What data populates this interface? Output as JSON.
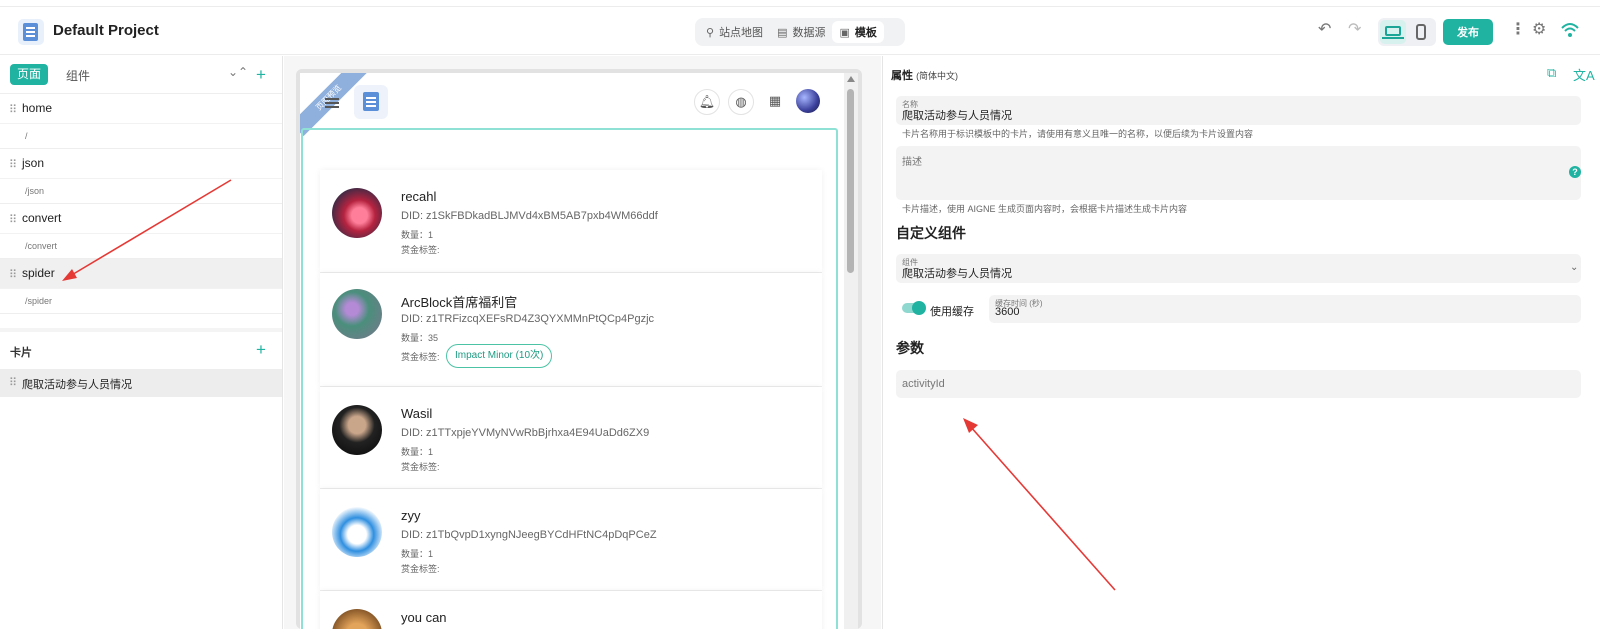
{
  "header": {
    "title": "Default Project",
    "tabs": [
      {
        "label": "站点地图",
        "icon": "sitemap-icon"
      },
      {
        "label": "数据源",
        "icon": "database-icon"
      },
      {
        "label": "模板",
        "icon": "template-icon",
        "active": true
      }
    ],
    "publish_label": "发布",
    "accent_color": "#21b3a2"
  },
  "left": {
    "tabs": {
      "pages": "页面",
      "components": "组件"
    },
    "pages": [
      {
        "name": "home",
        "path": "/"
      },
      {
        "name": "json",
        "path": "/json"
      },
      {
        "name": "convert",
        "path": "/convert"
      },
      {
        "name": "spider",
        "path": "/spider",
        "selected": true
      }
    ],
    "cards_header": "卡片",
    "cards": [
      {
        "name": "爬取活动参与人员情况",
        "selected": true
      }
    ]
  },
  "preview": {
    "ribbon": "页面预览",
    "users": [
      {
        "name": "recahl",
        "did": "DID: z1SkFBDkadBLJMVd4xBM5AB7pxb4WM66ddf",
        "count": "数量：1",
        "tags_label": "赏金标签:",
        "badge": ""
      },
      {
        "name": "ArcBlock首席福利官",
        "did": "DID: z1TRFizcqXEFsRD4Z3QYXMMnPtQCp4Pgzjc",
        "count": "数量：35",
        "tags_label": "赏金标签:",
        "badge": "Impact Minor (10次)"
      },
      {
        "name": "Wasil",
        "did": "DID: z1TTxpjeYVMyNVwRbBjrhxa4E94UaDd6ZX9",
        "count": "数量：1",
        "tags_label": "赏金标签:",
        "badge": ""
      },
      {
        "name": "zyy",
        "did": "DID: z1TbQvpD1xyngNJeegBYCdHFtNC4pDqPCeZ",
        "count": "数量：1",
        "tags_label": "赏金标签:",
        "badge": ""
      },
      {
        "name": "you can",
        "did": "",
        "count": "",
        "tags_label": "",
        "badge": ""
      }
    ]
  },
  "props": {
    "title": "属性",
    "locale": "(简体中文)",
    "name_label": "名称",
    "name_value": "爬取活动参与人员情况",
    "name_helper": "卡片名称用于标识模板中的卡片，请使用有意义且唯一的名称，以便后续为卡片设置内容",
    "desc_label": "描述",
    "desc_helper": "卡片描述，使用 AIGNE 生成页面内容时，会根据卡片描述生成卡片内容",
    "custom_section": "自定义组件",
    "component_label": "组件",
    "component_value": "爬取活动参与人员情况",
    "cache_toggle_label": "使用缓存",
    "cache_toggle_on": true,
    "cache_time_label": "缓存时间 (秒)",
    "cache_time_value": "3600",
    "params_section": "参数",
    "param_placeholder": "activityId"
  }
}
